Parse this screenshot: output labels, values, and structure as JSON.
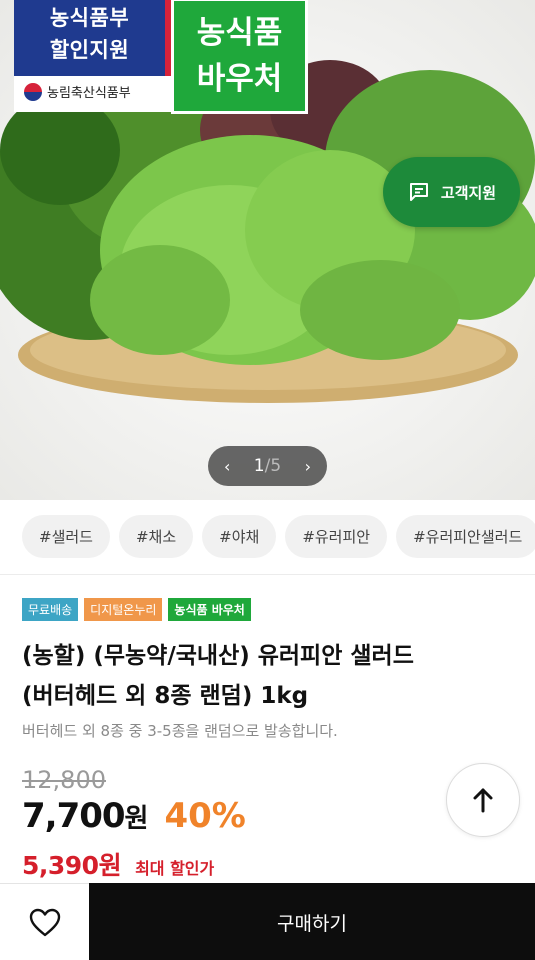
{
  "hero": {
    "badge_left_line1": "농식품부",
    "badge_left_line2": "할인지원",
    "ministry": "농림축산식품부",
    "badge_right_line1": "농식품",
    "badge_right_line2": "바우처",
    "customer_support": "고객지원",
    "pager": {
      "current": "1",
      "separator": "/",
      "total": "5"
    }
  },
  "tags": [
    "#샐러드",
    "#채소",
    "#야채",
    "#유러피안",
    "#유러피안샐러드"
  ],
  "labels": {
    "free_shipping": "무료배송",
    "onnuri": "디지털온누리",
    "voucher": "농식품 바우처"
  },
  "product": {
    "title_line1": "(농할) (무농약/국내산) 유러피안 샐러드",
    "title_line2": "(버터헤드 외 8종 랜덤) 1kg",
    "subtitle": "버터헤드 외 8종 중 3-5종을 랜덤으로 발송합니다.",
    "original_price": "12,800",
    "price": "7,700",
    "price_unit": "원",
    "discount": "40%",
    "max_discount_price": "5,390원",
    "max_discount_label": "최대 할인가"
  },
  "bottom": {
    "buy_label": "구매하기"
  },
  "colors": {
    "voucher_green": "#1fa83b",
    "discount_orange": "#f0832a",
    "max_red": "#d51f2b",
    "support_green": "#1d8a3a"
  }
}
